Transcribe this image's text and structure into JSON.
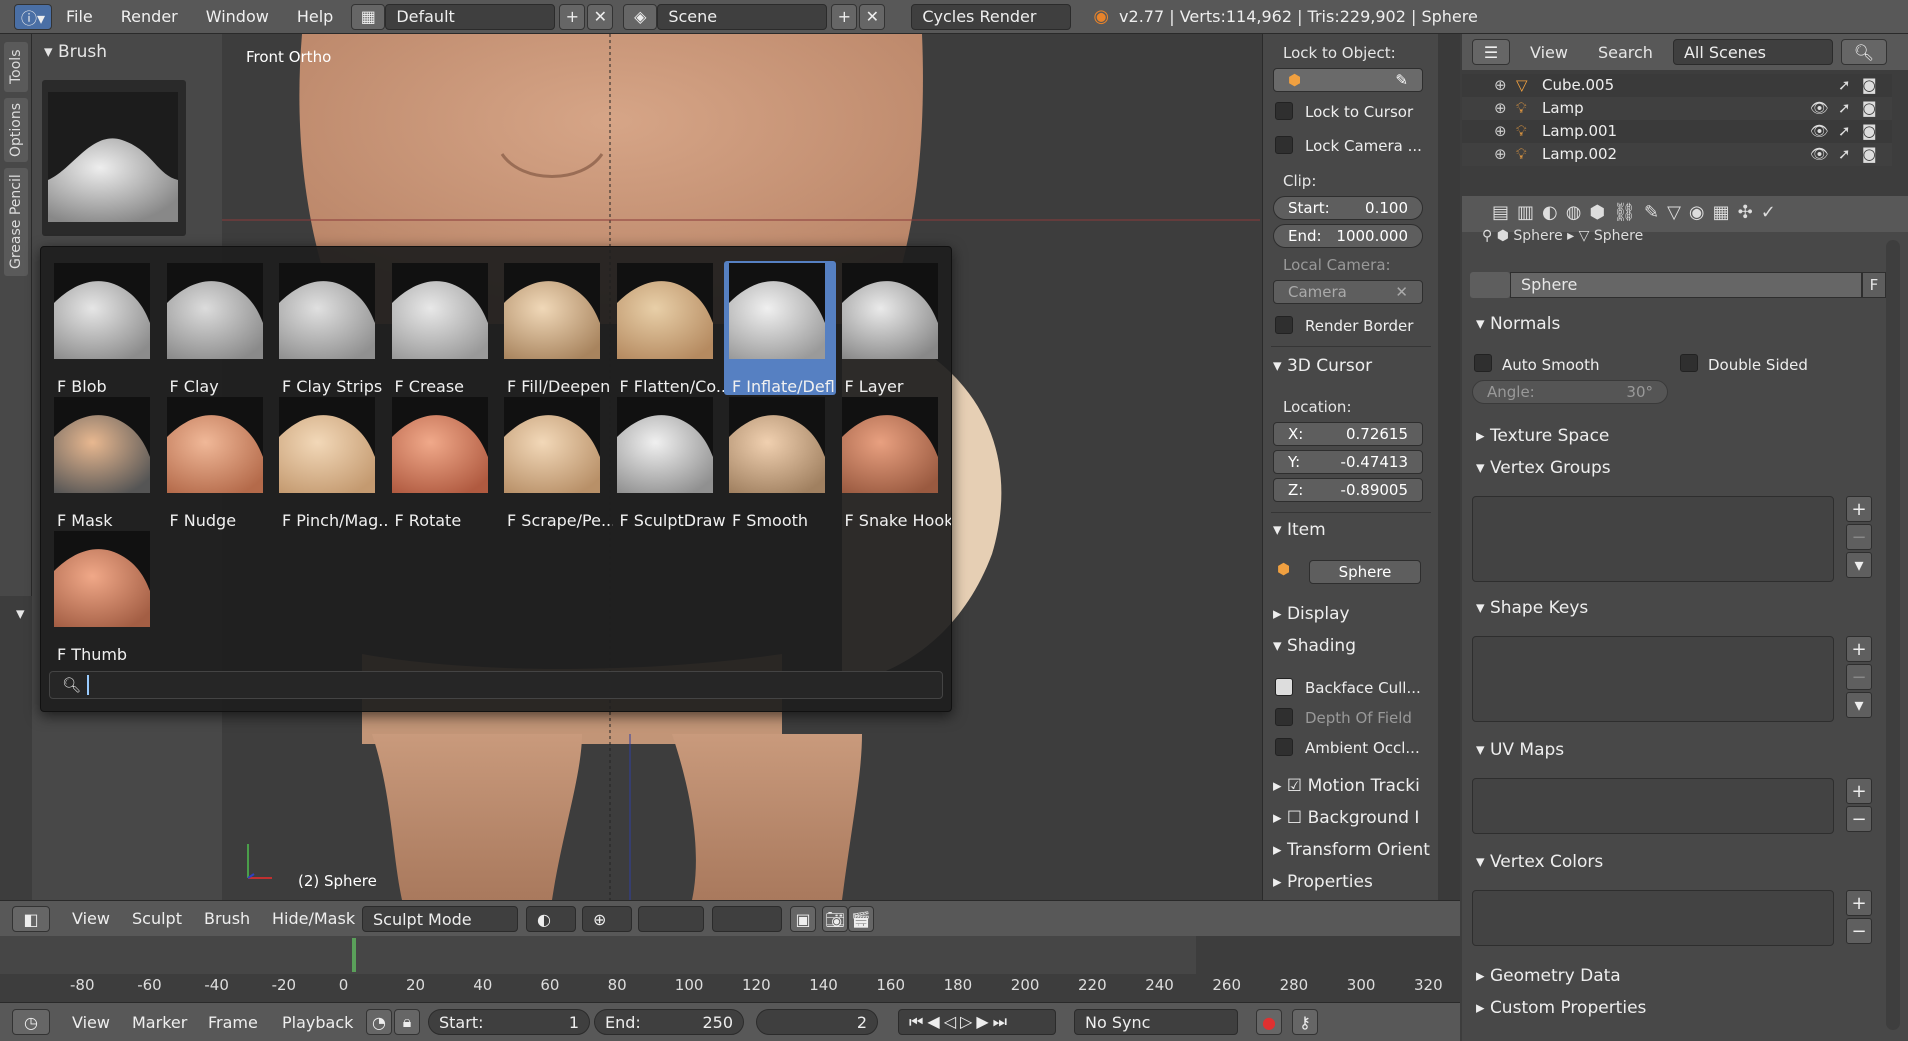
{
  "topbar": {
    "menus": [
      "File",
      "Render",
      "Window",
      "Help"
    ],
    "layout": "Default",
    "scene": "Scene",
    "engine": "Cycles Render",
    "stats": "v2.77 | Verts:114,962 | Tris:229,902 | Sphere"
  },
  "toolshelf": {
    "tabs": [
      "Tools",
      "Options",
      "Grease Pencil"
    ],
    "panel_title": "Brush"
  },
  "viewport": {
    "view_label": "Front Ortho",
    "object_label": "(2) Sphere"
  },
  "brushes": [
    {
      "label": "F Blob",
      "selected": false
    },
    {
      "label": "F Clay",
      "selected": false
    },
    {
      "label": "F Clay Strips",
      "selected": false
    },
    {
      "label": "F Crease",
      "selected": false
    },
    {
      "label": "F Fill/Deepen",
      "selected": false
    },
    {
      "label": "F Flatten/Co...",
      "selected": false
    },
    {
      "label": "F Inflate/Defl",
      "selected": true
    },
    {
      "label": "F Layer",
      "selected": false
    },
    {
      "label": "F Mask",
      "selected": false
    },
    {
      "label": "F Nudge",
      "selected": false
    },
    {
      "label": "F Pinch/Mag...",
      "selected": false
    },
    {
      "label": "F Rotate",
      "selected": false
    },
    {
      "label": "F Scrape/Pe...",
      "selected": false
    },
    {
      "label": "F SculptDraw",
      "selected": false
    },
    {
      "label": "F Smooth",
      "selected": false
    },
    {
      "label": "F Snake Hook",
      "selected": false
    },
    {
      "label": "F Thumb",
      "selected": false
    }
  ],
  "npanel": {
    "lock_to_object": "Lock to Object:",
    "lock_to_cursor": "Lock to Cursor",
    "lock_camera": "Lock Camera ...",
    "clip": "Clip:",
    "clip_start_label": "Start:",
    "clip_start": "0.100",
    "clip_end_label": "End:",
    "clip_end": "1000.000",
    "local_camera": "Local Camera:",
    "camera": "Camera",
    "render_border": "Render Border",
    "cursor_title": "3D Cursor",
    "location": "Location:",
    "x_label": "X:",
    "x": "0.72615",
    "y_label": "Y:",
    "y": "-0.47413",
    "z_label": "Z:",
    "z": "-0.89005",
    "item_title": "Item",
    "item_name": "Sphere",
    "display": "Display",
    "shading": "Shading",
    "backface": "Backface Cull...",
    "dof": "Depth Of Field",
    "ao": "Ambient Occl...",
    "motion": "Motion Tracki",
    "background": "Background I",
    "transform": "Transform Orient",
    "properties": "Properties"
  },
  "outliner": {
    "view": "View",
    "search": "Search",
    "scenes": "All Scenes",
    "items": [
      "Cube.005",
      "Lamp",
      "Lamp.001",
      "Lamp.002"
    ]
  },
  "props": {
    "crumb1": "Sphere",
    "crumb2": "Sphere",
    "mesh_name": "Sphere",
    "fake": "F",
    "normals": "Normals",
    "auto_smooth": "Auto Smooth",
    "double_sided": "Double Sided",
    "angle_label": "Angle:",
    "angle": "30°",
    "texture_space": "Texture Space",
    "vertex_groups": "Vertex Groups",
    "shape_keys": "Shape Keys",
    "uv_maps": "UV Maps",
    "vertex_colors": "Vertex Colors",
    "geometry_data": "Geometry Data",
    "custom_properties": "Custom Properties"
  },
  "viewheader": {
    "view": "View",
    "sculpt": "Sculpt",
    "brush": "Brush",
    "hidemask": "Hide/Mask",
    "mode": "Sculpt Mode"
  },
  "timeline": {
    "ticks": [
      "-80",
      "-60",
      "-40",
      "-20",
      "0",
      "20",
      "40",
      "60",
      "80",
      "100",
      "120",
      "140",
      "160",
      "180",
      "200",
      "220",
      "240",
      "260",
      "280",
      "300",
      "320"
    ],
    "view": "View",
    "marker": "Marker",
    "frame": "Frame",
    "playback": "Playback",
    "start_label": "Start:",
    "start": "1",
    "end_label": "End:",
    "end": "250",
    "current": "2",
    "sync": "No Sync"
  }
}
